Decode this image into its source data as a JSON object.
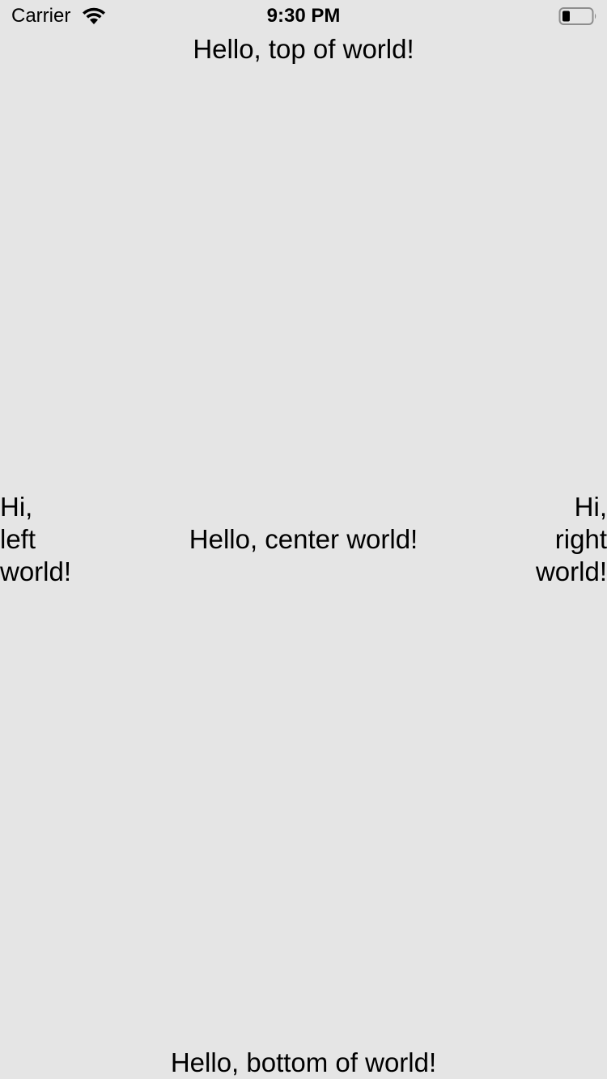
{
  "status_bar": {
    "carrier": "Carrier",
    "time": "9:30 PM",
    "wifi_icon": "wifi-icon",
    "battery_icon": "battery-icon"
  },
  "labels": {
    "top": "Hello, top of world!",
    "center": "Hello, center world!",
    "bottom": "Hello, bottom of world!",
    "left": [
      "Hi,",
      "left",
      "world!"
    ],
    "right": [
      "Hi,",
      "right",
      "world!"
    ]
  }
}
